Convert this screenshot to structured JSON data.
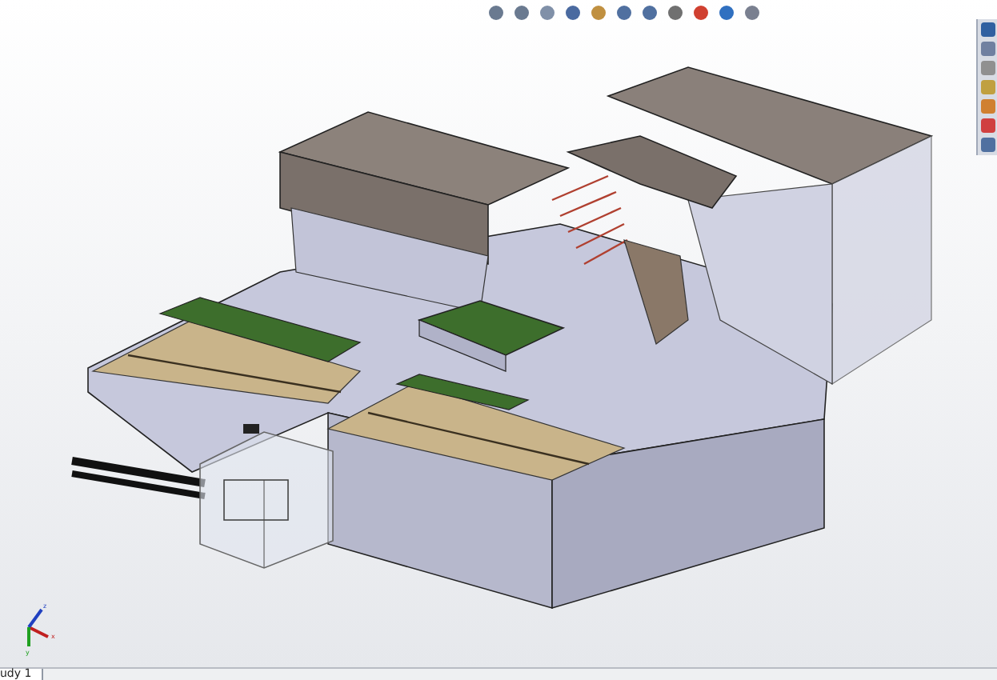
{
  "viewport": {
    "triad": {
      "x": "x",
      "y": "y",
      "z": "z"
    }
  },
  "bottom_tabs": [
    {
      "label": "udy 1",
      "selected": true
    }
  ]
}
